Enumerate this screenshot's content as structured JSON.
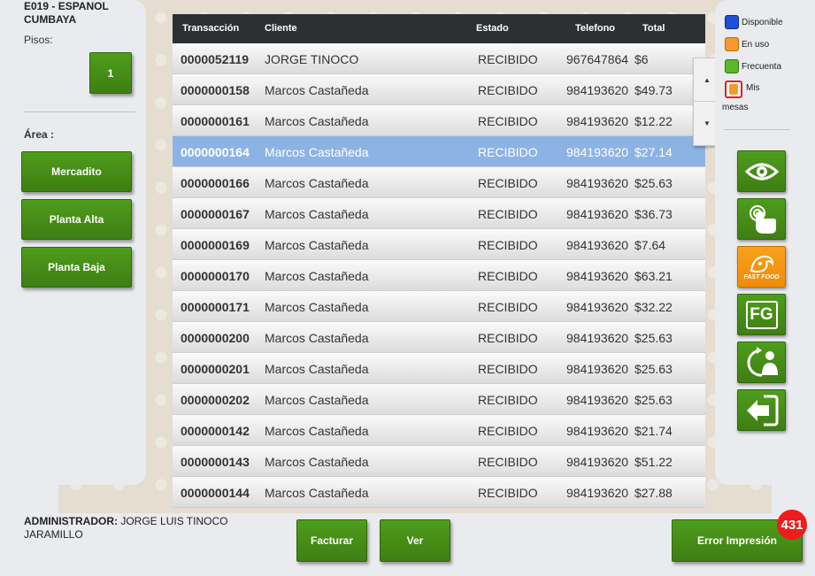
{
  "store": {
    "line1": "E019 - ESPANOL",
    "line2": "CUMBAYA"
  },
  "pisos": {
    "label": "Pisos:",
    "current": "1"
  },
  "area": {
    "label": "Área :",
    "items": [
      {
        "label": "Mercadito"
      },
      {
        "label": "Planta Alta"
      },
      {
        "label": "Planta Baja"
      }
    ]
  },
  "table": {
    "columns": [
      "Transacción",
      "Cliente",
      "Estado",
      "Telefono",
      "Total"
    ],
    "selected_index": 3,
    "rows": [
      {
        "trans": "0000052119",
        "cliente": "JORGE TINOCO",
        "estado": "RECIBIDO",
        "tel": "967647864",
        "total": "$6"
      },
      {
        "trans": "0000000158",
        "cliente": "Marcos Castañeda",
        "estado": "RECIBIDO",
        "tel": "984193620",
        "total": "$49.73"
      },
      {
        "trans": "0000000161",
        "cliente": "Marcos Castañeda",
        "estado": "RECIBIDO",
        "tel": "984193620",
        "total": "$12.22"
      },
      {
        "trans": "0000000164",
        "cliente": "Marcos Castañeda",
        "estado": "RECIBIDO",
        "tel": "984193620",
        "total": "$27.14"
      },
      {
        "trans": "0000000166",
        "cliente": "Marcos Castañeda",
        "estado": "RECIBIDO",
        "tel": "984193620",
        "total": "$25.63"
      },
      {
        "trans": "0000000167",
        "cliente": "Marcos Castañeda",
        "estado": "RECIBIDO",
        "tel": "984193620",
        "total": "$36.73"
      },
      {
        "trans": "0000000169",
        "cliente": "Marcos Castañeda",
        "estado": "RECIBIDO",
        "tel": "984193620",
        "total": "$7.64"
      },
      {
        "trans": "0000000170",
        "cliente": "Marcos Castañeda",
        "estado": "RECIBIDO",
        "tel": "984193620",
        "total": "$63.21"
      },
      {
        "trans": "0000000171",
        "cliente": "Marcos Castañeda",
        "estado": "RECIBIDO",
        "tel": "984193620",
        "total": "$32.22"
      },
      {
        "trans": "0000000200",
        "cliente": "Marcos Castañeda",
        "estado": "RECIBIDO",
        "tel": "984193620",
        "total": "$25.63"
      },
      {
        "trans": "0000000201",
        "cliente": "Marcos Castañeda",
        "estado": "RECIBIDO",
        "tel": "984193620",
        "total": "$25.63"
      },
      {
        "trans": "0000000202",
        "cliente": "Marcos Castañeda",
        "estado": "RECIBIDO",
        "tel": "984193620",
        "total": "$25.63"
      },
      {
        "trans": "0000000142",
        "cliente": "Marcos Castañeda",
        "estado": "RECIBIDO",
        "tel": "984193620",
        "total": "$21.74"
      },
      {
        "trans": "0000000143",
        "cliente": "Marcos Castañeda",
        "estado": "RECIBIDO",
        "tel": "984193620",
        "total": "$51.22"
      },
      {
        "trans": "0000000144",
        "cliente": "Marcos Castañeda",
        "estado": "RECIBIDO",
        "tel": "984193620",
        "total": "$27.88"
      }
    ]
  },
  "legend": [
    {
      "label": "Disponible",
      "color": "#1f4fd6"
    },
    {
      "label": "En uso",
      "color": "#f39a2a"
    },
    {
      "label": "Frecuenta",
      "color": "#5cb82a"
    },
    {
      "label": "Mis mesas",
      "color": "#f39a2a"
    }
  ],
  "side_buttons": [
    {
      "icon": "eye-icon"
    },
    {
      "icon": "touch-hand-icon"
    },
    {
      "icon": "fast-food-icon",
      "text": "FAST FOOD"
    },
    {
      "icon": "fg-icon",
      "text": "FG"
    },
    {
      "icon": "refresh-user-icon"
    },
    {
      "icon": "exit-arrow-icon"
    }
  ],
  "admin": {
    "label": "ADMINISTRADOR:",
    "name": "JORGE LUIS TINOCO",
    "name2": "JARAMILLO"
  },
  "footer": {
    "facturar": "Facturar",
    "ver": "Ver",
    "error": "Error Impresión",
    "error_count": "431"
  }
}
